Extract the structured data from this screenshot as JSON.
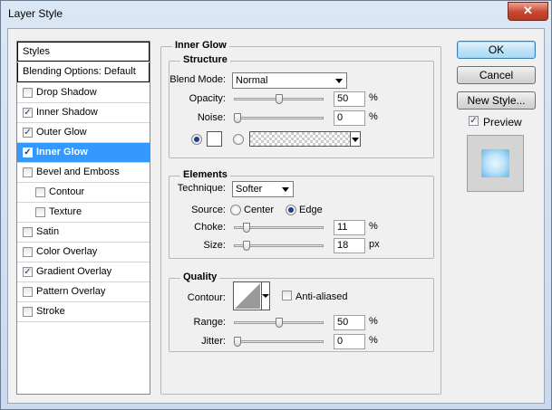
{
  "window": {
    "title": "Layer Style",
    "close_glyph": "✕"
  },
  "styles_list": {
    "header": "Styles",
    "blending_options": "Blending Options: Default",
    "items": [
      {
        "label": "Drop Shadow",
        "checked": false,
        "indent": false,
        "selected": false
      },
      {
        "label": "Inner Shadow",
        "checked": true,
        "indent": false,
        "selected": false
      },
      {
        "label": "Outer Glow",
        "checked": true,
        "indent": false,
        "selected": false
      },
      {
        "label": "Inner Glow",
        "checked": true,
        "indent": false,
        "selected": true
      },
      {
        "label": "Bevel and Emboss",
        "checked": false,
        "indent": false,
        "selected": false
      },
      {
        "label": "Contour",
        "checked": false,
        "indent": true,
        "selected": false
      },
      {
        "label": "Texture",
        "checked": false,
        "indent": true,
        "selected": false
      },
      {
        "label": "Satin",
        "checked": false,
        "indent": false,
        "selected": false
      },
      {
        "label": "Color Overlay",
        "checked": false,
        "indent": false,
        "selected": false
      },
      {
        "label": "Gradient Overlay",
        "checked": true,
        "indent": false,
        "selected": false
      },
      {
        "label": "Pattern Overlay",
        "checked": false,
        "indent": false,
        "selected": false
      },
      {
        "label": "Stroke",
        "checked": false,
        "indent": false,
        "selected": false
      }
    ]
  },
  "inner_glow": {
    "title": "Inner Glow",
    "structure": {
      "title": "Structure",
      "blend_mode_label": "Blend Mode:",
      "blend_mode_value": "Normal",
      "opacity_label": "Opacity:",
      "opacity_value": "50",
      "opacity_percent": 50,
      "noise_label": "Noise:",
      "noise_value": "0",
      "noise_percent": 0,
      "percent_unit": "%",
      "color_swatch": "#ffffff",
      "color_selected": true
    },
    "elements": {
      "title": "Elements",
      "technique_label": "Technique:",
      "technique_value": "Softer",
      "source_label": "Source:",
      "source_center": "Center",
      "source_edge": "Edge",
      "source_selected": "Edge",
      "choke_label": "Choke:",
      "choke_value": "11",
      "choke_percent": 11,
      "size_label": "Size:",
      "size_value": "18",
      "size_unit": "px",
      "percent_unit": "%"
    },
    "quality": {
      "title": "Quality",
      "contour_label": "Contour:",
      "anti_aliased_label": "Anti-aliased",
      "anti_aliased_checked": false,
      "range_label": "Range:",
      "range_value": "50",
      "range_percent": 50,
      "jitter_label": "Jitter:",
      "jitter_value": "0",
      "jitter_percent": 0,
      "percent_unit": "%"
    }
  },
  "buttons": {
    "ok": "OK",
    "cancel": "Cancel",
    "new_style": "New Style...",
    "preview_label": "Preview",
    "preview_checked": true
  },
  "colors": {
    "selection": "#3399ff",
    "preview_glow": "#5fb8ee"
  }
}
